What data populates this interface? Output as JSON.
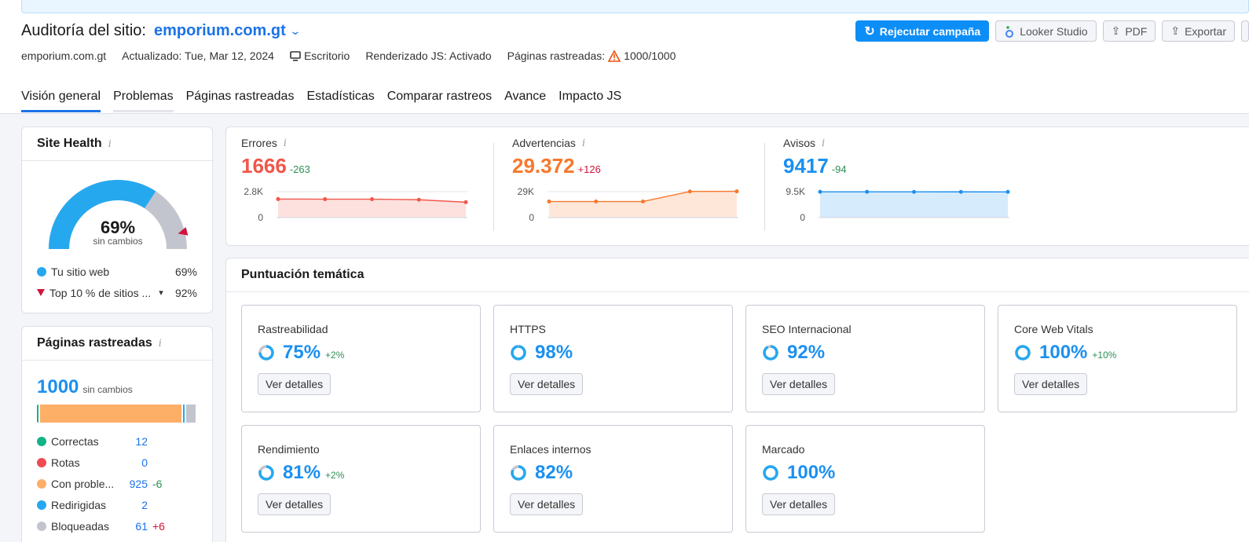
{
  "header": {
    "title_prefix": "Auditoría del sitio:",
    "domain": "emporium.com.gt",
    "meta": {
      "site": "emporium.com.gt",
      "updated": "Actualizado: Tue, Mar 12, 2024",
      "device": "Escritorio",
      "js_render": "Renderizado JS: Activado",
      "crawled_label": "Páginas rastreadas:",
      "crawled_value": "1000/1000"
    },
    "buttons": {
      "rerun": "Rejecutar campaña",
      "looker": "Looker Studio",
      "pdf": "PDF",
      "export": "Exportar"
    },
    "tabs": [
      "Visión general",
      "Problemas",
      "Páginas rastreadas",
      "Estadísticas",
      "Comparar rastreos",
      "Avance",
      "Impacto JS"
    ]
  },
  "site_health": {
    "title": "Site Health",
    "percent": "69%",
    "percent_value": 69,
    "subtitle": "sin cambios",
    "legend": [
      {
        "label": "Tu sitio web",
        "value": "69%",
        "color": "#26a8ef"
      },
      {
        "label": "Top 10 % de sitios ...",
        "value": "92%",
        "color": "#d1133d"
      }
    ]
  },
  "pages": {
    "title": "Páginas rastreadas",
    "total": "1000",
    "total_note": "sin cambios",
    "items": [
      {
        "label": "Correctas",
        "value": "12",
        "delta": "",
        "color": "#13b386"
      },
      {
        "label": "Rotas",
        "value": "0",
        "delta": "",
        "color": "#ef4a52"
      },
      {
        "label": "Con proble...",
        "value": "925",
        "delta": "-6",
        "color": "#fdaf68"
      },
      {
        "label": "Redirigidas",
        "value": "2",
        "delta": "",
        "color": "#26a8ef"
      },
      {
        "label": "Bloqueadas",
        "value": "61",
        "delta": "+6",
        "color": "#c2c5cd"
      }
    ]
  },
  "metrics": [
    {
      "label": "Errores",
      "value": "1666",
      "delta": "-263",
      "color": "#f2564a",
      "ymax": "2.8K",
      "ymin": "0",
      "points": [
        2000,
        1990,
        1990,
        1930,
        1666
      ],
      "max": 2800
    },
    {
      "label": "Advertencias",
      "value": "29.372",
      "delta": "+126",
      "color": "#f7782c",
      "ymax": "29K",
      "ymin": "0",
      "points": [
        18000,
        18000,
        18000,
        29200,
        29372
      ],
      "max": 29000
    },
    {
      "label": "Avisos",
      "value": "9417",
      "delta": "-94",
      "color": "#1b90f0",
      "ymax": "9.5K",
      "ymin": "0",
      "points": [
        9450,
        9450,
        9440,
        9430,
        9417
      ],
      "max": 9500
    }
  ],
  "thematic": {
    "title": "Puntuación temática",
    "button": "Ver detalles",
    "items": [
      {
        "name": "Rastreabilidad",
        "pct": "75%",
        "value": 75,
        "delta": "+2%"
      },
      {
        "name": "HTTPS",
        "pct": "98%",
        "value": 98,
        "delta": ""
      },
      {
        "name": "SEO Internacional",
        "pct": "92%",
        "value": 92,
        "delta": ""
      },
      {
        "name": "Core Web Vitals",
        "pct": "100%",
        "value": 100,
        "delta": "+10%"
      },
      {
        "name": "Rendimiento",
        "pct": "81%",
        "value": 81,
        "delta": "+2%"
      },
      {
        "name": "Enlaces internos",
        "pct": "82%",
        "value": 82,
        "delta": ""
      },
      {
        "name": "Marcado",
        "pct": "100%",
        "value": 100,
        "delta": ""
      }
    ]
  }
}
